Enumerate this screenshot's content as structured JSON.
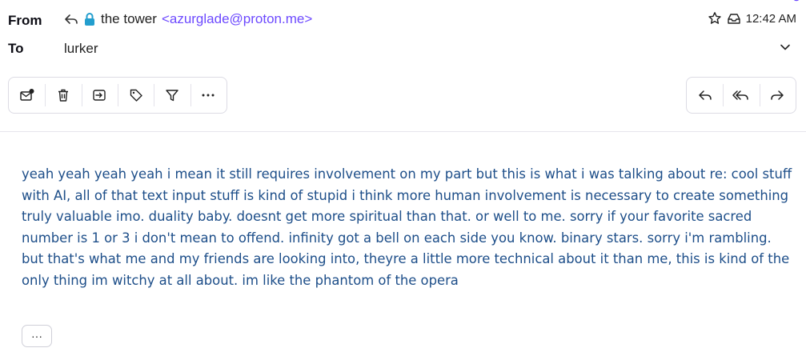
{
  "header": {
    "from_label": "From",
    "to_label": "To",
    "sender_name": "the tower",
    "sender_address": "<azurglade@proton.me>",
    "recipient": "lurker",
    "time": "12:42 AM",
    "icons": [
      "reply-arrow-icon",
      "lock-icon",
      "star-icon",
      "inbox-tray-icon",
      "chevron-down-icon"
    ]
  },
  "toolbar": {
    "left_actions": [
      "mark-unread",
      "trash",
      "move-to",
      "label",
      "filter",
      "more"
    ],
    "right_actions": [
      "reply",
      "reply-all",
      "forward"
    ]
  },
  "message": {
    "body": "yeah yeah yeah yeah i mean it still requires involvement on my part but this is what i was talking about re: cool stuff with AI, all of that text input stuff is kind of stupid i think more human involvement is necessary to create something truly valuable imo. duality baby. doesnt get more spiritual than that. or well to me. sorry if your favorite sacred number is 1 or 3 i don't mean to offend. infinity got a bell on each side you know. binary stars. sorry i'm rambling. but that's what me and my friends are looking into, theyre a little more technical about it than me, this is kind of the only thing im witchy at all about. im like the phantom of the opera",
    "expand_label": "···"
  },
  "colors": {
    "accent": "#6d4aff",
    "body_text": "#1d4e89"
  }
}
